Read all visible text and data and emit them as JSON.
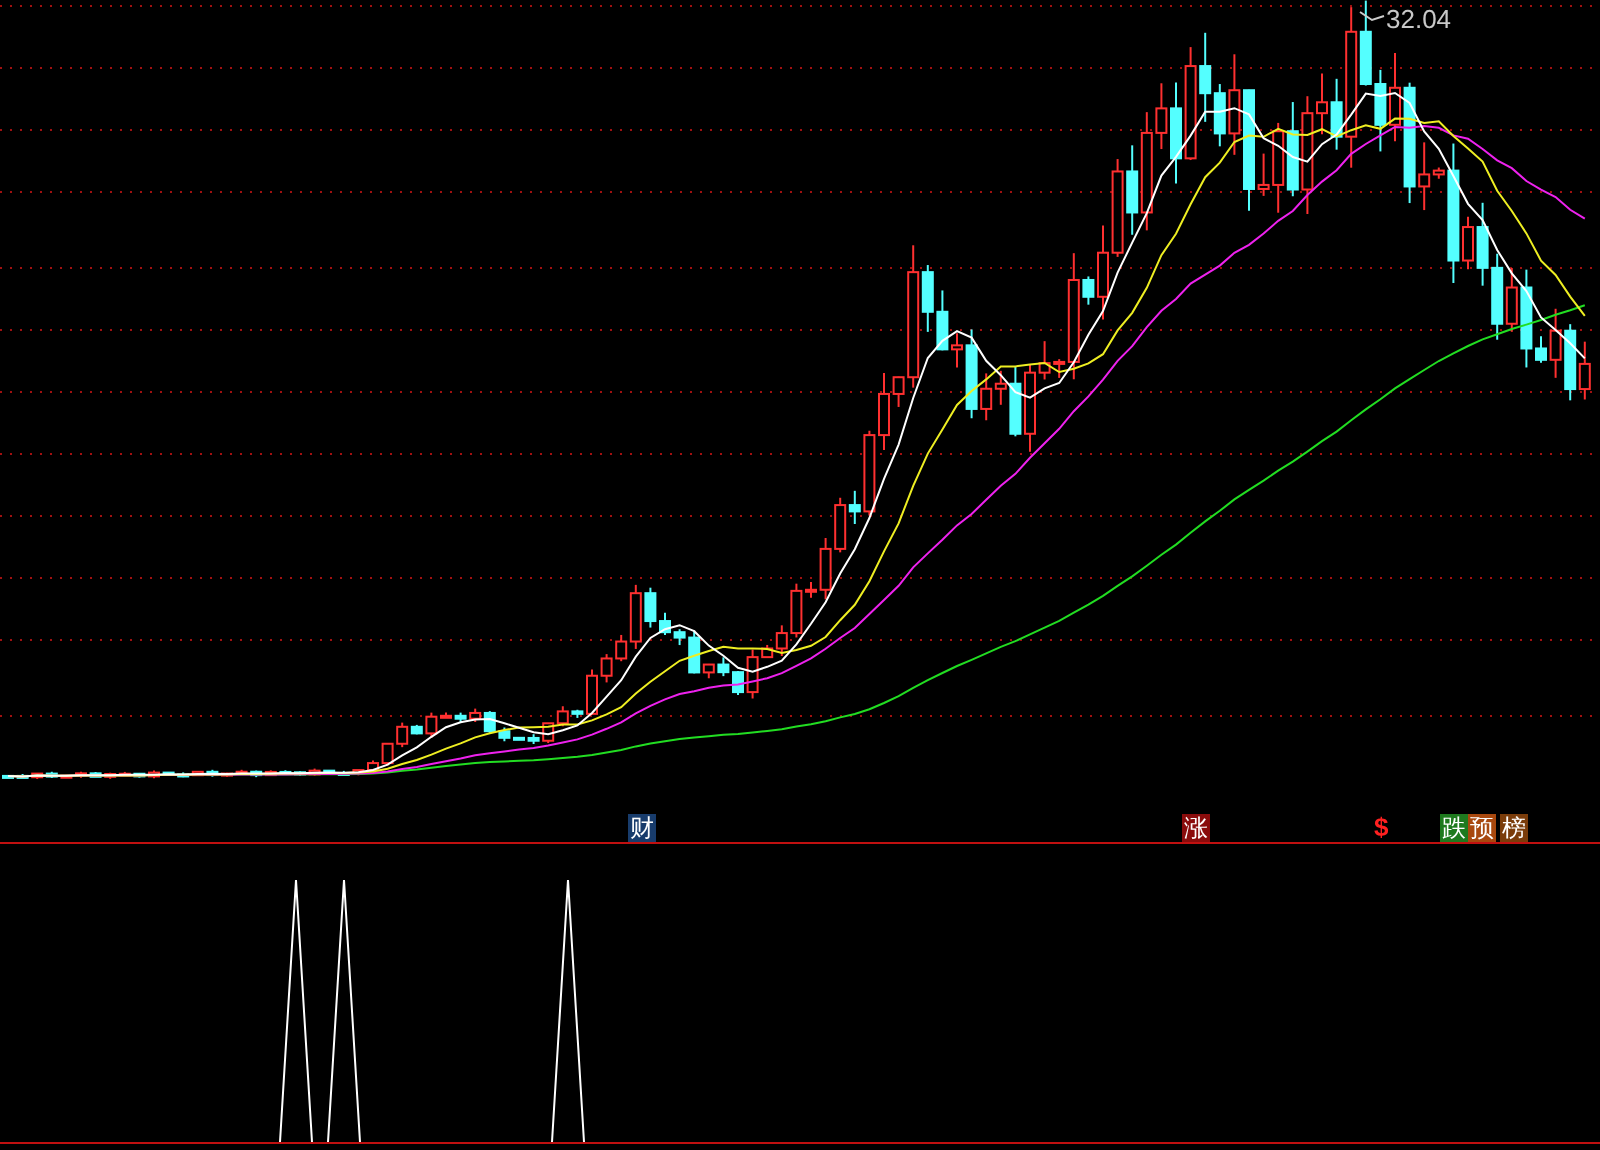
{
  "chart": {
    "price_label": "32.04"
  },
  "markers": [
    {
      "kind": "badge",
      "text": "财",
      "color": "#183c6c"
    },
    {
      "kind": "badge",
      "text": "涨",
      "color": "#8a0c0c"
    },
    {
      "kind": "glyph",
      "text": "$",
      "color": "#ff2020"
    },
    {
      "kind": "badge",
      "text": "跌",
      "color": "#1e7a1e"
    },
    {
      "kind": "badge",
      "text": "预",
      "color": "#a8480e"
    },
    {
      "kind": "badge",
      "text": "榜",
      "color": "#7a3c0a"
    }
  ]
}
